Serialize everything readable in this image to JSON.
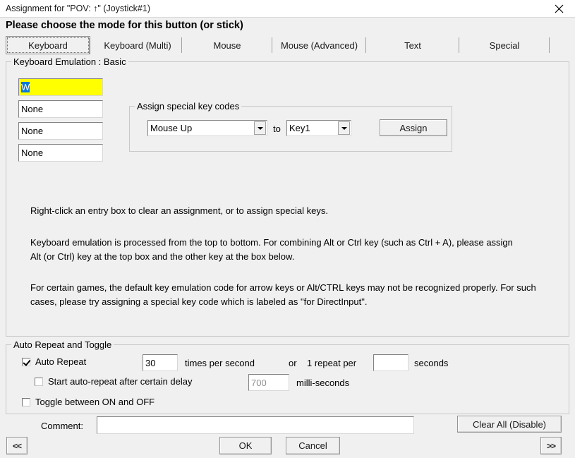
{
  "window": {
    "title": "Assignment for \"POV: ↑\" (Joystick#1)",
    "close_label": "✕"
  },
  "heading": "Please choose the mode for this button (or stick)",
  "tabs": [
    {
      "label": "Keyboard",
      "selected": true
    },
    {
      "label": "Keyboard (Multi)",
      "selected": false
    },
    {
      "label": "Mouse",
      "selected": false
    },
    {
      "label": "Mouse (Advanced)",
      "selected": false
    },
    {
      "label": "Text",
      "selected": false
    },
    {
      "label": "Special",
      "selected": false
    }
  ],
  "keyboard_basic": {
    "group_title": "Keyboard Emulation : Basic",
    "entries": [
      {
        "value": "W",
        "selected_text": true,
        "highlight": "yellow"
      },
      {
        "value": "None",
        "selected_text": false,
        "highlight": "none"
      },
      {
        "value": "None",
        "selected_text": false,
        "highlight": "none"
      },
      {
        "value": "None",
        "selected_text": false,
        "highlight": "none"
      }
    ],
    "special_keys": {
      "group_title": "Assign special key codes",
      "source_combo_value": "Mouse Up",
      "to_label": "to",
      "target_combo_value": "Key1",
      "assign_button": "Assign"
    },
    "help_lines": [
      "Right-click an entry box to clear an assignment, or to assign special keys.",
      "Keyboard emulation is processed from the top to bottom.  For combining Alt or Ctrl key (such as Ctrl + A), please assign Alt (or Ctrl) key at the top box and the other key at the box below.",
      "For certain games, the default key emulation code for arrow keys or Alt/CTRL keys may not be recognized properly. For such cases, please try assigning a special key code which is labeled as \"for DirectInput\"."
    ]
  },
  "auto_repeat": {
    "group_title": "Auto Repeat and Toggle",
    "auto_repeat_label": "Auto Repeat",
    "auto_repeat_checked": true,
    "rate_value": "30",
    "times_per_second_label": "times per second",
    "or_label": "or",
    "one_repeat_per_label": "1 repeat per",
    "seconds_value": "",
    "seconds_label": "seconds",
    "delay_label": "Start auto-repeat after certain delay",
    "delay_checked": false,
    "delay_value": "700",
    "delay_value_disabled": true,
    "milliseconds_label": "milli-seconds",
    "toggle_label": "Toggle between ON and OFF",
    "toggle_checked": false
  },
  "footer": {
    "comment_label": "Comment:",
    "comment_value": "",
    "clear_all_label": "Clear All (Disable)",
    "prev_label": "<<",
    "ok_label": "OK",
    "cancel_label": "Cancel",
    "next_label": ">>"
  },
  "colors": {
    "window_bg": "#f0f0f0",
    "titlebar_bg": "#ffffff",
    "highlight_yellow": "#ffff00",
    "selection_blue": "#0a78d7",
    "disabled_text": "#8f8f8f"
  }
}
